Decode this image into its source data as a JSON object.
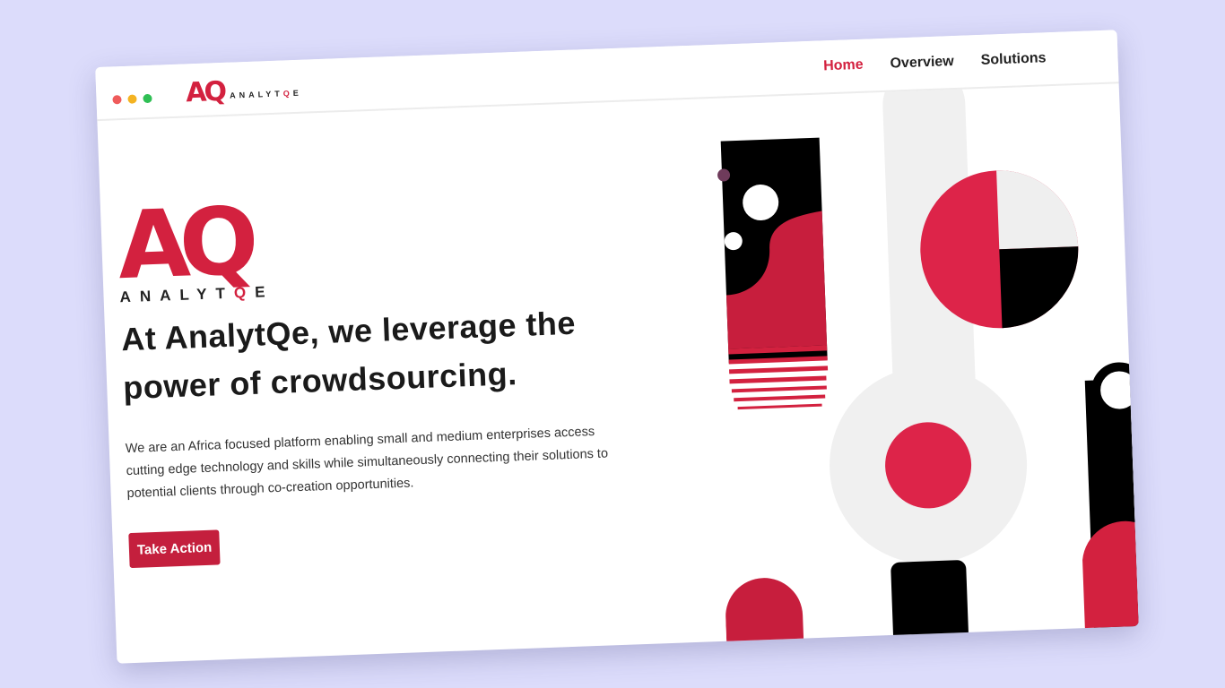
{
  "brand": {
    "mark": "AQ",
    "word_prefix": "ANALYT",
    "word_q": "Q",
    "word_suffix": "E"
  },
  "nav": {
    "items": [
      {
        "label": "Home",
        "active": true
      },
      {
        "label": "Overview",
        "active": false
      },
      {
        "label": "Solutions",
        "active": false
      }
    ]
  },
  "hero": {
    "headline": "At AnalytQe, we leverage the power of crowdsourcing.",
    "description": "We are an Africa focused platform enabling small and medium enterprises access cutting edge technology and skills while simultaneously connecting their solutions to potential clients through co-creation opportunities.",
    "cta_label": "Take Action"
  },
  "colors": {
    "accent": "#d3213f",
    "button": "#c41f3d",
    "black": "#000000",
    "light_grey": "#f0f0f0",
    "background": "#dcdcfb"
  },
  "icons": [
    "window-close-dot",
    "window-minimize-dot",
    "window-maximize-dot"
  ]
}
